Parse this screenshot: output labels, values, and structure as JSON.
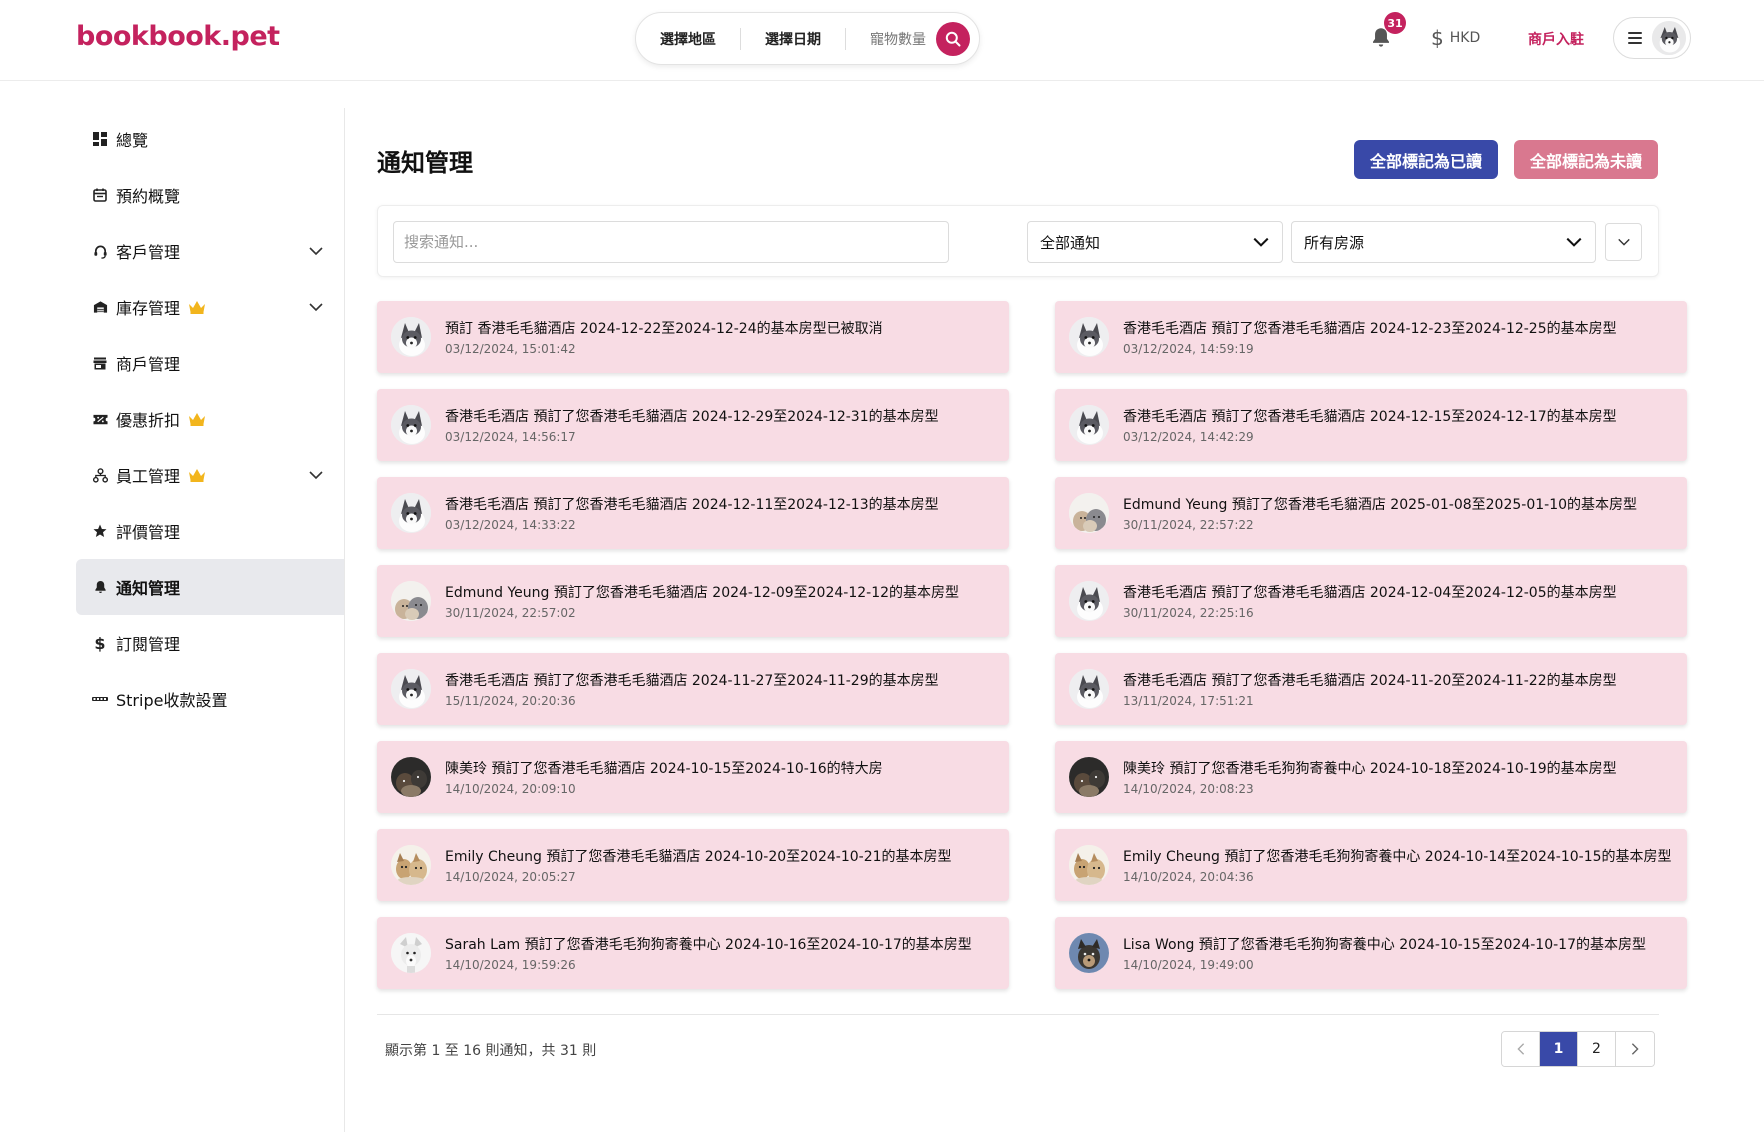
{
  "header": {
    "logo": "bookbook.pet",
    "search": {
      "region_label": "選擇地區",
      "date_label": "選擇日期",
      "pets_label": "寵物數量"
    },
    "notification_count": "31",
    "currency": "HKD",
    "merchant_link": "商戶入駐"
  },
  "sidebar": {
    "items": [
      {
        "label": "總覽",
        "icon": "dashboard-icon"
      },
      {
        "label": "預約概覽",
        "icon": "calendar-icon"
      },
      {
        "label": "客戶管理",
        "icon": "headset-icon",
        "expandable": true
      },
      {
        "label": "庫存管理",
        "icon": "warehouse-icon",
        "premium": true,
        "expandable": true
      },
      {
        "label": "商戶管理",
        "icon": "store-icon"
      },
      {
        "label": "優惠折扣",
        "icon": "ticket-icon",
        "premium": true
      },
      {
        "label": "員工管理",
        "icon": "people-icon",
        "premium": true,
        "expandable": true
      },
      {
        "label": "評價管理",
        "icon": "star-icon"
      },
      {
        "label": "通知管理",
        "icon": "bell-icon",
        "active": true
      },
      {
        "label": "訂閱管理",
        "icon": "dollar-icon"
      },
      {
        "label": "Stripe收款設置",
        "icon": "stripe-icon"
      }
    ]
  },
  "main": {
    "title": "通知管理",
    "mark_all_read": "全部標記為已讀",
    "mark_all_unread": "全部標記為未讀",
    "filters": {
      "search_placeholder": "搜索通知...",
      "type_selected": "全部通知",
      "property_selected": "所有房源"
    },
    "notifications": [
      {
        "message": "預訂 香港毛毛貓酒店 2024-12-22至2024-12-24的基本房型已被取消",
        "time": "03/12/2024, 15:01:42",
        "avatar": "husky"
      },
      {
        "message": "香港毛毛酒店 預訂了您香港毛毛貓酒店 2024-12-23至2024-12-25的基本房型",
        "time": "03/12/2024, 14:59:19",
        "avatar": "husky"
      },
      {
        "message": "香港毛毛酒店 預訂了您香港毛毛貓酒店 2024-12-29至2024-12-31的基本房型",
        "time": "03/12/2024, 14:56:17",
        "avatar": "husky"
      },
      {
        "message": "香港毛毛酒店 預訂了您香港毛毛貓酒店 2024-12-15至2024-12-17的基本房型",
        "time": "03/12/2024, 14:42:29",
        "avatar": "husky"
      },
      {
        "message": "香港毛毛酒店 預訂了您香港毛毛貓酒店 2024-12-11至2024-12-13的基本房型",
        "time": "03/12/2024, 14:33:22",
        "avatar": "husky"
      },
      {
        "message": "Edmund Yeung 預訂了您香港毛毛貓酒店 2025-01-08至2025-01-10的基本房型",
        "time": "30/11/2024, 22:57:22",
        "avatar": "cats"
      },
      {
        "message": "Edmund Yeung 預訂了您香港毛毛貓酒店 2024-12-09至2024-12-12的基本房型",
        "time": "30/11/2024, 22:57:02",
        "avatar": "cats"
      },
      {
        "message": "香港毛毛酒店 預訂了您香港毛毛貓酒店 2024-12-04至2024-12-05的基本房型",
        "time": "30/11/2024, 22:25:16",
        "avatar": "husky"
      },
      {
        "message": "香港毛毛酒店 預訂了您香港毛毛貓酒店 2024-11-27至2024-11-29的基本房型",
        "time": "15/11/2024, 20:20:36",
        "avatar": "husky"
      },
      {
        "message": "香港毛毛酒店 預訂了您香港毛毛貓酒店 2024-11-20至2024-11-22的基本房型",
        "time": "13/11/2024, 17:51:21",
        "avatar": "husky"
      },
      {
        "message": "陳美玲 預訂了您香港毛毛貓酒店 2024-10-15至2024-10-16的特大房",
        "time": "14/10/2024, 20:09:10",
        "avatar": "dark"
      },
      {
        "message": "陳美玲 預訂了您香港毛毛狗狗寄養中心 2024-10-18至2024-10-19的基本房型",
        "time": "14/10/2024, 20:08:23",
        "avatar": "dark"
      },
      {
        "message": "Emily Cheung 預訂了您香港毛毛貓酒店 2024-10-20至2024-10-21的基本房型",
        "time": "14/10/2024, 20:05:27",
        "avatar": "dogs"
      },
      {
        "message": "Emily Cheung 預訂了您香港毛毛狗狗寄養中心 2024-10-14至2024-10-15的基本房型",
        "time": "14/10/2024, 20:04:36",
        "avatar": "dogs"
      },
      {
        "message": "Sarah Lam 預訂了您香港毛毛狗狗寄養中心 2024-10-16至2024-10-17的基本房型",
        "time": "14/10/2024, 19:59:26",
        "avatar": "terrier"
      },
      {
        "message": "Lisa Wong 預訂了您香港毛毛狗狗寄養中心 2024-10-15至2024-10-17的基本房型",
        "time": "14/10/2024, 19:49:00",
        "avatar": "bluedog"
      }
    ],
    "summary": "顯示第 1 至 16 則通知，共 31 則",
    "pagination": {
      "pages": [
        "1",
        "2"
      ],
      "current": "1"
    }
  },
  "colors": {
    "brand": "#c4225e",
    "primary_button": "#3949a8",
    "secondary_button": "#d9788f",
    "notification_bg": "#f8dce4"
  }
}
